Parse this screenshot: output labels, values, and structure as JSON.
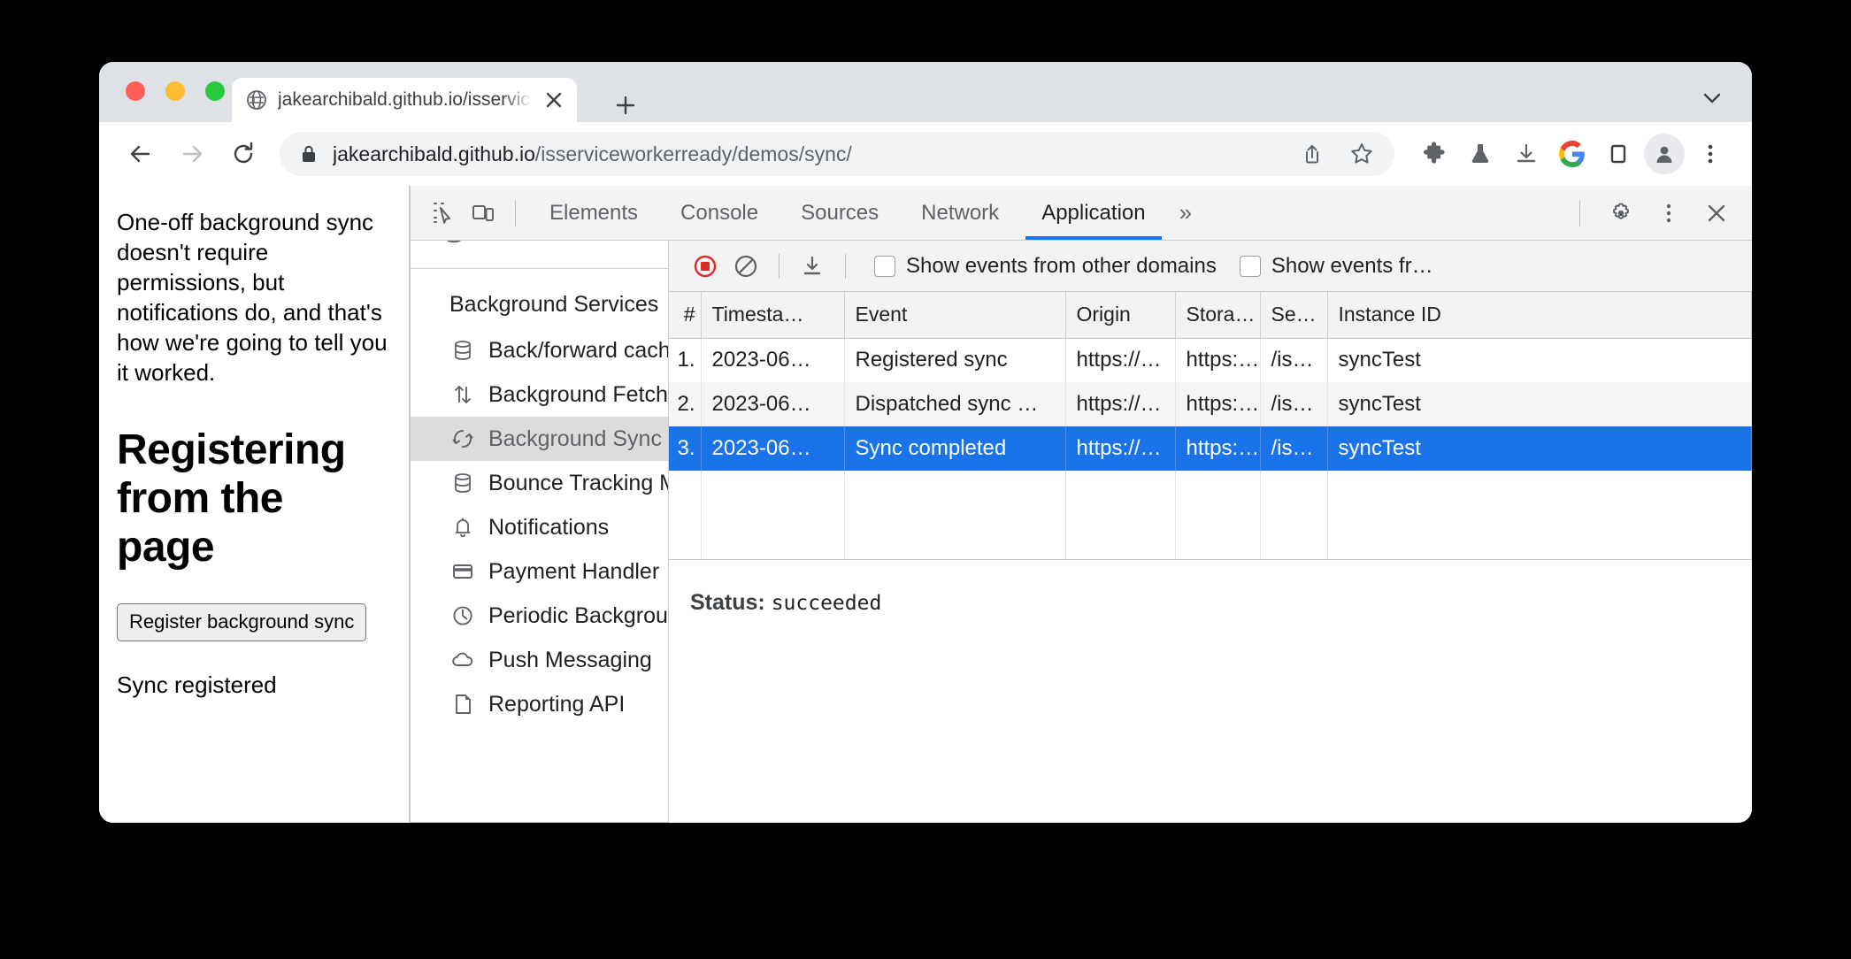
{
  "browser": {
    "tab": {
      "title": "jakearchibald.github.io/isservic",
      "favicon": "globe-icon",
      "close": "×",
      "newtab": "+"
    },
    "omnibox": {
      "secure_icon": "lock-icon",
      "url_host": "jakearchibald.github.io",
      "url_path": "/isserviceworkerready/demos/sync/"
    },
    "toolbar_icons": [
      "share-icon",
      "bookmark-star-icon",
      "extensions-puzzle-icon",
      "experiments-flask-icon",
      "downloads-icon",
      "google-icon",
      "side-panel-icon",
      "profile-avatar-icon",
      "chrome-menu-icon"
    ],
    "nav_icons": [
      "back-arrow-icon",
      "forward-arrow-icon",
      "reload-icon"
    ]
  },
  "page": {
    "lead": "One-off background sync doesn't require permissions, but notifications do, and that's how we're going to tell you it worked.",
    "heading": "Registering from the page",
    "button_label": "Register background sync",
    "status": "Sync registered"
  },
  "devtools": {
    "tabs": [
      {
        "label": "Elements",
        "active": false
      },
      {
        "label": "Console",
        "active": false
      },
      {
        "label": "Sources",
        "active": false
      },
      {
        "label": "Network",
        "active": false
      },
      {
        "label": "Application",
        "active": true
      }
    ],
    "more_tabs": "»",
    "left_icons": [
      "inspect-element-icon",
      "device-toolbar-icon"
    ],
    "right_icons": [
      "settings-gear-icon",
      "devtools-menu-icon",
      "close-devtools-icon"
    ],
    "sidebar": {
      "partial_item_above": "Cut off manifest item",
      "group_title": "Background Services",
      "items": [
        {
          "label": "Back/forward cache",
          "icon": "database-icon",
          "selected": false
        },
        {
          "label": "Background Fetch",
          "icon": "arrows-up-down-icon",
          "selected": false
        },
        {
          "label": "Background Sync",
          "icon": "sync-refresh-icon",
          "selected": true
        },
        {
          "label": "Bounce Tracking Mi",
          "icon": "database-icon",
          "selected": false
        },
        {
          "label": "Notifications",
          "icon": "bell-icon",
          "selected": false
        },
        {
          "label": "Payment Handler",
          "icon": "credit-card-icon",
          "selected": false
        },
        {
          "label": "Periodic Backgroun",
          "icon": "clock-icon",
          "selected": false
        },
        {
          "label": "Push Messaging",
          "icon": "cloud-icon",
          "selected": false
        },
        {
          "label": "Reporting API",
          "icon": "document-icon",
          "selected": false
        }
      ]
    },
    "events_toolbar": {
      "record_icon": "record-stop-icon",
      "clear_icon": "clear-circle-slash-icon",
      "save_icon": "download-save-icon",
      "checkbox_other_domains": "Show events from other domains",
      "checkbox_other_storage": "Show events fr…"
    },
    "events_table": {
      "columns": [
        "#",
        "Timesta…",
        "Event",
        "Origin",
        "Stora…",
        "Se…",
        "Instance ID"
      ],
      "rows": [
        {
          "num": "1.",
          "timestamp": "2023-06…",
          "event": "Registered sync",
          "origin": "https://…",
          "storage": "https:…",
          "sw": "/is…",
          "instance": "syncTest",
          "selected": false
        },
        {
          "num": "2.",
          "timestamp": "2023-06…",
          "event": "Dispatched sync …",
          "origin": "https://…",
          "storage": "https:…",
          "sw": "/is…",
          "instance": "syncTest",
          "selected": false
        },
        {
          "num": "3.",
          "timestamp": "2023-06…",
          "event": "Sync completed",
          "origin": "https://…",
          "storage": "https:…",
          "sw": "/is…",
          "instance": "syncTest",
          "selected": true
        }
      ]
    },
    "detail": {
      "status_label": "Status:",
      "status_value": "succeeded"
    }
  },
  "colors": {
    "accent": "#1a73e8",
    "record": "#d93025",
    "tabstrip": "#dee1e6",
    "selected_row": "#1a73e8"
  }
}
